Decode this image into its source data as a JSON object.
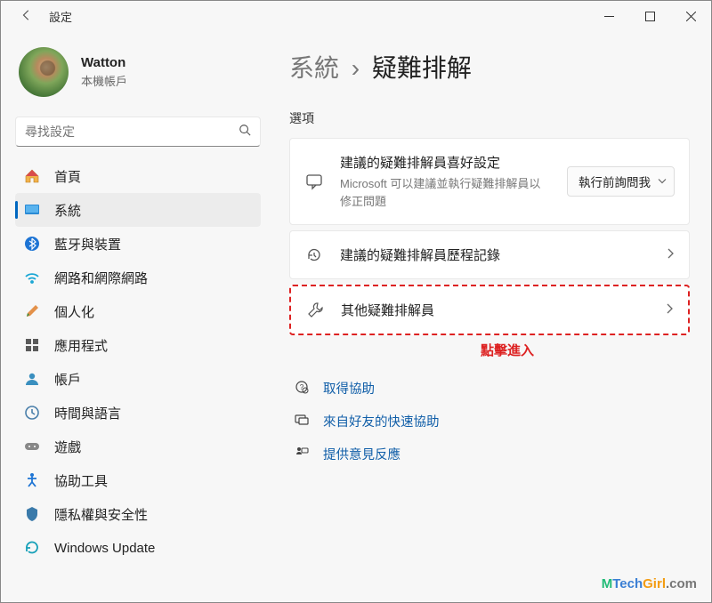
{
  "window": {
    "app_title": "設定"
  },
  "profile": {
    "name": "Watton",
    "subtitle": "本機帳戶"
  },
  "search": {
    "placeholder": "尋找設定"
  },
  "nav": [
    {
      "key": "home",
      "label": "首頁",
      "active": false
    },
    {
      "key": "system",
      "label": "系統",
      "active": true
    },
    {
      "key": "bluetooth",
      "label": "藍牙與裝置",
      "active": false
    },
    {
      "key": "network",
      "label": "網路和網際網路",
      "active": false
    },
    {
      "key": "personalization",
      "label": "個人化",
      "active": false
    },
    {
      "key": "apps",
      "label": "應用程式",
      "active": false
    },
    {
      "key": "accounts",
      "label": "帳戶",
      "active": false
    },
    {
      "key": "time",
      "label": "時間與語言",
      "active": false
    },
    {
      "key": "gaming",
      "label": "遊戲",
      "active": false
    },
    {
      "key": "accessibility",
      "label": "協助工具",
      "active": false
    },
    {
      "key": "privacy",
      "label": "隱私權與安全性",
      "active": false
    },
    {
      "key": "update",
      "label": "Windows Update",
      "active": false
    }
  ],
  "breadcrumb": {
    "root": "系統",
    "leaf": "疑難排解"
  },
  "section_heading": "選項",
  "cards": {
    "recommended": {
      "title": "建議的疑難排解員喜好設定",
      "desc": "Microsoft 可以建議並執行疑難排解員以修正問題",
      "select_value": "執行前詢問我"
    },
    "history": {
      "title": "建議的疑難排解員歷程記錄"
    },
    "other": {
      "title": "其他疑難排解員"
    }
  },
  "annotation": "點擊進入",
  "links": {
    "help": "取得協助",
    "quick": "來自好友的快速協助",
    "feedback": "提供意見反應"
  },
  "watermark": {
    "full": "MTechGirl.com"
  }
}
